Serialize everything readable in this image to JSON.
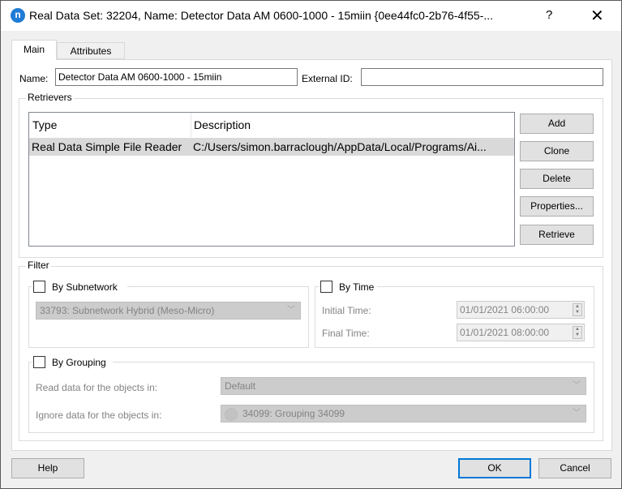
{
  "window": {
    "title": "Real Data Set: 32204, Name: Detector Data AM 0600-1000 - 15miin  {0ee44fc0-2b76-4f55-...",
    "app_icon": "n",
    "help_glyph": "?",
    "close_glyph": "✕"
  },
  "tabs": [
    {
      "label": "Main",
      "active": true
    },
    {
      "label": "Attributes",
      "active": false
    }
  ],
  "main": {
    "name_label": "Name:",
    "name_value": "Detector Data AM 0600-1000 - 15miin",
    "external_id_label": "External ID:",
    "external_id_value": "",
    "retrievers": {
      "title": "Retrievers",
      "columns": [
        "Type",
        "Description"
      ],
      "rows": [
        {
          "type": "Real Data Simple File Reader",
          "description": "C:/Users/simon.barraclough/AppData/Local/Programs/Ai..."
        }
      ],
      "buttons": {
        "add": "Add",
        "clone": "Clone",
        "delete": "Delete",
        "properties": "Properties...",
        "retrieve": "Retrieve"
      }
    },
    "filter": {
      "title": "Filter",
      "by_subnetwork": {
        "label": "By Subnetwork",
        "checked": false,
        "selected": "33793: Subnetwork Hybrid (Meso-Micro)"
      },
      "by_time": {
        "label": "By Time",
        "checked": false,
        "initial_label": "Initial Time:",
        "initial_value": "01/01/2021 06:00:00",
        "final_label": "Final Time:",
        "final_value": "01/01/2021 08:00:00"
      },
      "by_grouping": {
        "label": "By Grouping",
        "checked": false,
        "read_label": "Read data for the objects in:",
        "read_value": "Default",
        "ignore_label": "Ignore data for the objects in:",
        "ignore_value": "34099: Grouping 34099"
      }
    }
  },
  "footer": {
    "help": "Help",
    "ok": "OK",
    "cancel": "Cancel"
  },
  "icons": {
    "chevron_down": "﹀",
    "spin_up": "▲",
    "spin_down": "▼"
  }
}
